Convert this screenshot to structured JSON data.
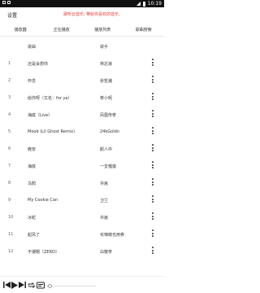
{
  "status_bar": {
    "time": "10:19"
  },
  "header": {
    "title": "设置",
    "marquee": "歌听云音乐, 带给你喜欢的音乐,"
  },
  "tabs": [
    {
      "label": "播放器"
    },
    {
      "label": "正在播放"
    },
    {
      "label": "播放列表"
    },
    {
      "label": "歌曲搜索"
    }
  ],
  "columns": {
    "song": "歌曲",
    "artist": "歌手"
  },
  "songs": [
    {
      "num": "1",
      "title": "还是会想你",
      "artist": "林达浪"
    },
    {
      "num": "2",
      "title": "怀念",
      "artist": "张哲瀚"
    },
    {
      "num": "3",
      "title": "给你呀（又名：for ya）",
      "artist": "蒋小呢"
    },
    {
      "num": "4",
      "title": "海底（Live）",
      "artist": "凤凰传奇"
    },
    {
      "num": "5",
      "title": "Mood (Lil Ghost Remix)",
      "artist": "24kGoldn"
    },
    {
      "num": "6",
      "title": "晚安",
      "artist": "颜人中"
    },
    {
      "num": "7",
      "title": "海底",
      "artist": "一支榴莲"
    },
    {
      "num": "8",
      "title": "乌鸦",
      "artist": "许嵩"
    },
    {
      "num": "9",
      "title": "My Cookie Can",
      "artist": "卫兰"
    },
    {
      "num": "10",
      "title": "冰蛇",
      "artist": "许嵩"
    },
    {
      "num": "11",
      "title": "起风了",
      "artist": "买辣椒也用券"
    },
    {
      "num": "12",
      "title": "不潮帽（ZERO）",
      "artist": "白敬亭"
    }
  ],
  "player": {
    "progress": 0.05
  }
}
